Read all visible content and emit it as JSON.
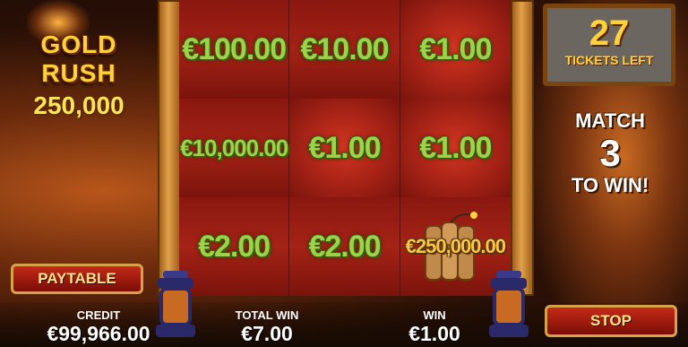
{
  "game": {
    "logo_title": "GOLD RUSH",
    "logo_prize": "250,000"
  },
  "grid": {
    "cells": [
      {
        "label": "€100.00"
      },
      {
        "label": "€10.00"
      },
      {
        "label": "€1.00"
      },
      {
        "label": "€10,000.00"
      },
      {
        "label": "€1.00"
      },
      {
        "label": "€1.00"
      },
      {
        "label": "€2.00"
      },
      {
        "label": "€2.00"
      },
      {
        "label": "€250,000.00",
        "icon": "dynamite-icon"
      }
    ]
  },
  "tickets": {
    "count": "27",
    "label": "TICKETS LEFT"
  },
  "rule": {
    "line1": "MATCH",
    "number": "3",
    "line2": "TO WIN!"
  },
  "buttons": {
    "paytable": "PAYTABLE",
    "stop": "STOP"
  },
  "meters": {
    "credit_label": "CREDIT",
    "credit_value": "€99,966.00",
    "total_win_label": "TOTAL WIN",
    "total_win_value": "€7.00",
    "win_label": "WIN",
    "win_value": "€1.00"
  },
  "colors": {
    "prize_green": "#9ed24a",
    "gold": "#ffd23a",
    "panel_red": "#a52216"
  }
}
